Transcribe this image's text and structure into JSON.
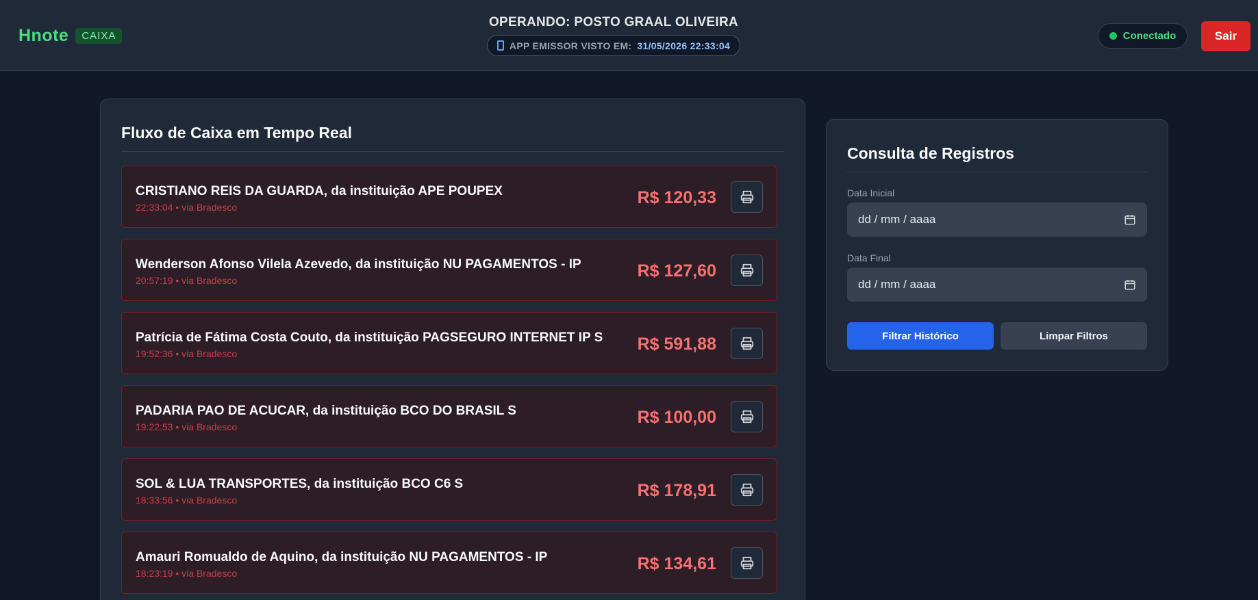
{
  "header": {
    "brand": "Hnote",
    "badge": "CAIXA",
    "operating": "OPERANDO: POSTO GRAAL OLIVEIRA",
    "emitter_label": "APP EMISSOR VISTO EM:",
    "emitter_timestamp": "31/05/2026 22:33:04",
    "status": "Conectado",
    "logout": "Sair"
  },
  "flow": {
    "title": "Fluxo de Caixa em Tempo Real",
    "transactions": [
      {
        "name": "CRISTIANO REIS DA GUARDA, da instituição APE POUPEX",
        "meta": "22:33:04 • via Bradesco",
        "amount": "R$ 120,33"
      },
      {
        "name": "Wenderson Afonso Vilela Azevedo, da instituição NU PAGAMENTOS - IP",
        "meta": "20:57:19 • via Bradesco",
        "amount": "R$ 127,60"
      },
      {
        "name": "Patrícia de Fátima Costa Couto, da instituição PAGSEGURO INTERNET IP S",
        "meta": "19:52:36 • via Bradesco",
        "amount": "R$ 591,88"
      },
      {
        "name": "PADARIA PAO DE ACUCAR, da instituição BCO DO BRASIL S",
        "meta": "19:22:53 • via Bradesco",
        "amount": "R$ 100,00"
      },
      {
        "name": "SOL & LUA TRANSPORTES, da instituição BCO C6 S",
        "meta": "18:33:56 • via Bradesco",
        "amount": "R$ 178,91"
      },
      {
        "name": "Amauri Romualdo de Aquino, da instituição NU PAGAMENTOS - IP",
        "meta": "18:23:19 • via Bradesco",
        "amount": "R$ 134,61"
      }
    ]
  },
  "filters": {
    "title": "Consulta de Registros",
    "start_label": "Data Inicial",
    "start_placeholder": "dd / mm / aaaa",
    "end_label": "Data Final",
    "end_placeholder": "dd / mm / aaaa",
    "apply": "Filtrar Histórico",
    "clear": "Limpar Filtros"
  }
}
